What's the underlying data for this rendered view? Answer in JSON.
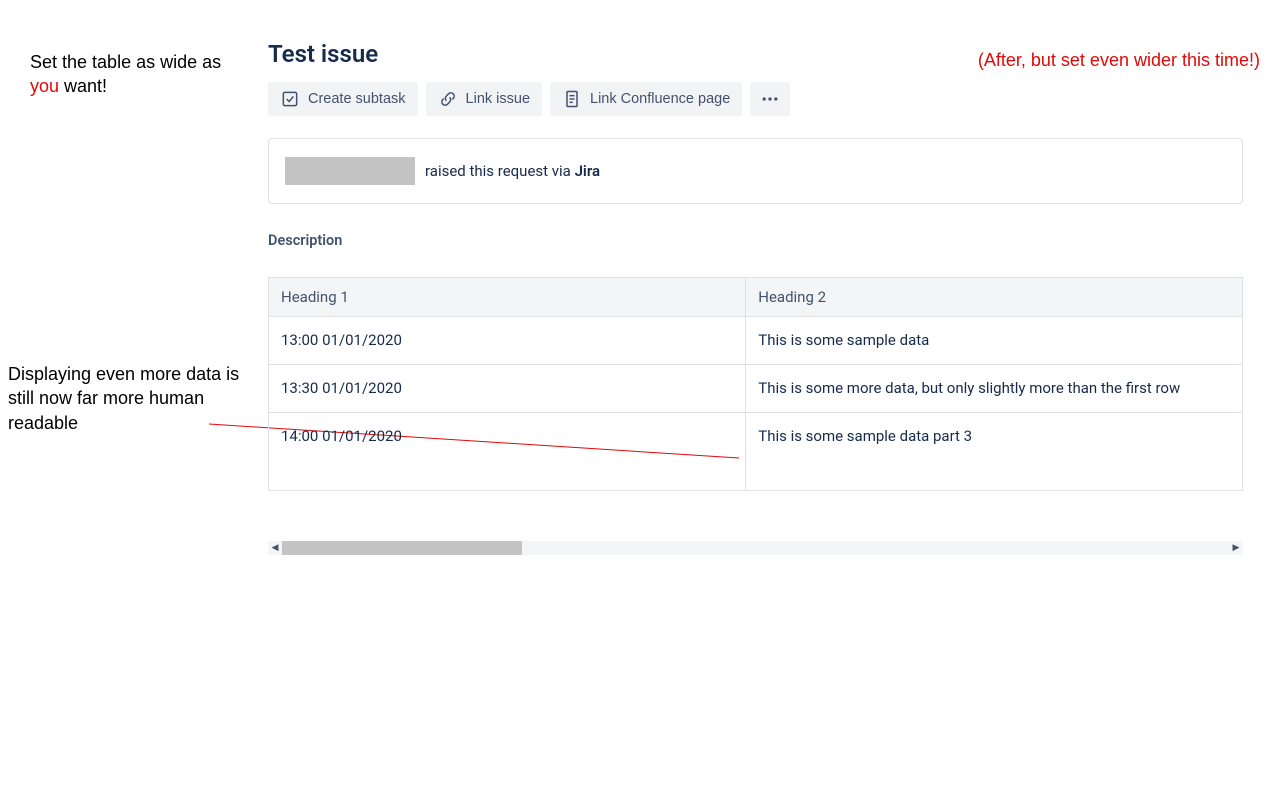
{
  "annotations": {
    "top_left_part1": "Set the table as wide as ",
    "top_left_red": "you",
    "top_left_part2": " want!",
    "top_right": "(After, but set even wider this time!)",
    "mid_left": "Displaying even more data is still now far more human readable"
  },
  "issue": {
    "title": "Test issue",
    "actions": {
      "create_subtask": "Create subtask",
      "link_issue": "Link issue",
      "link_confluence": "Link Confluence page"
    },
    "request_panel_text_prefix": "raised this request via ",
    "request_panel_text_bold": "Jira",
    "description_label": "Description"
  },
  "table": {
    "headers": [
      "Heading 1",
      "Heading 2"
    ],
    "rows": [
      [
        "13:00 01/01/2020",
        "This is some sample data"
      ],
      [
        "13:30 01/01/2020",
        "This is some more data, but only slightly more than the first row"
      ],
      [
        "14:00 01/01/2020",
        "This is some sample data part 3"
      ]
    ]
  }
}
